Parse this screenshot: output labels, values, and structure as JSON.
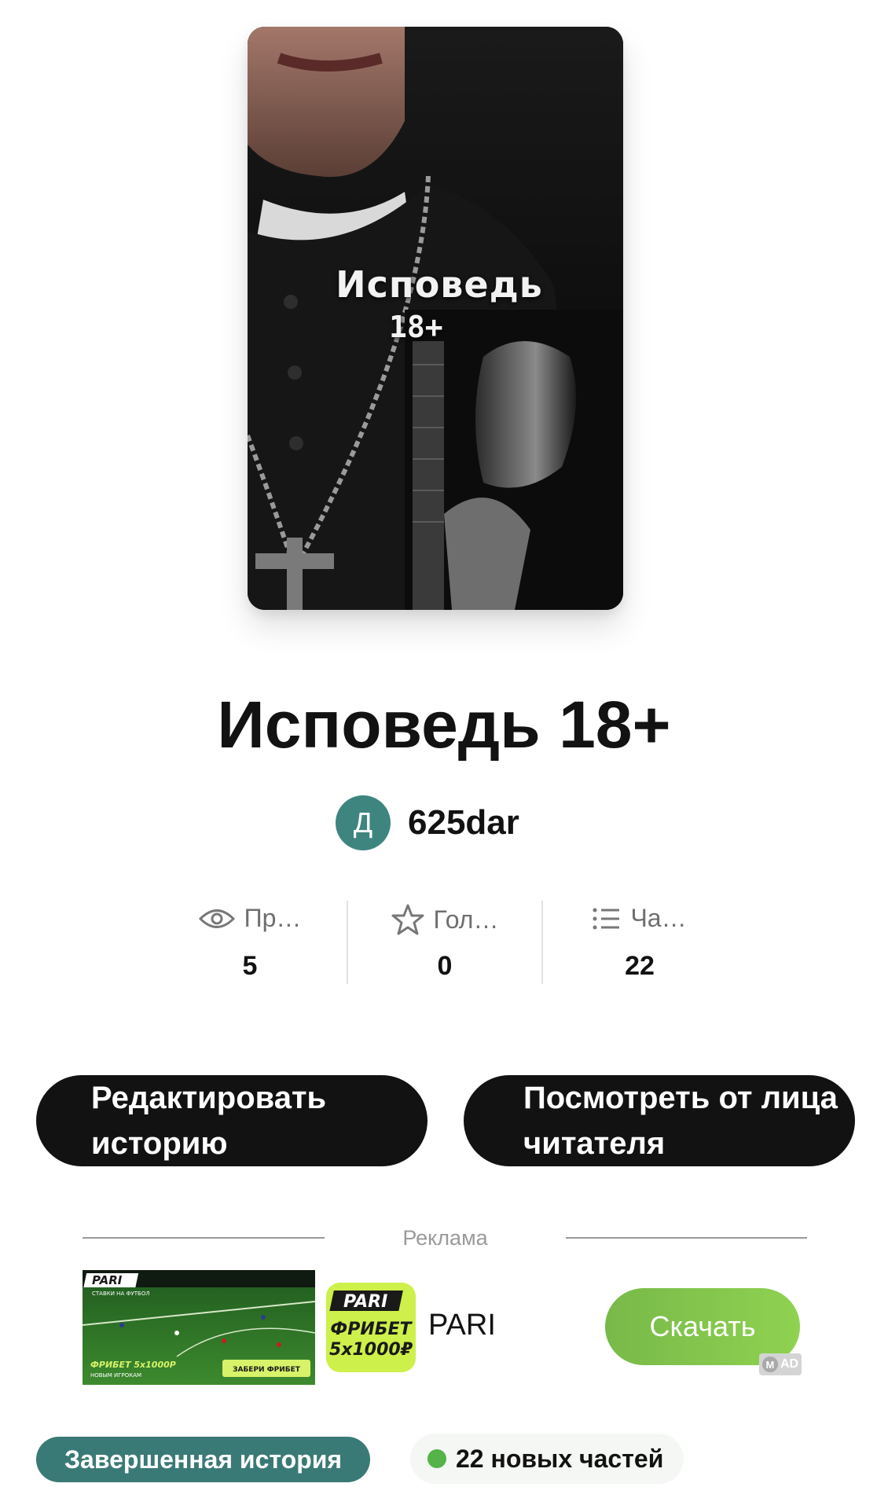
{
  "cover": {
    "title": "Исповедь",
    "subtitle": "18+"
  },
  "story": {
    "title": "Исповедь 18+"
  },
  "author": {
    "initial": "Д",
    "name": "625dar",
    "avatar_color": "#3e8580"
  },
  "stats": [
    {
      "label": "Пр…",
      "value": "5",
      "icon": "eye-icon"
    },
    {
      "label": "Гол…",
      "value": "0",
      "icon": "star-icon"
    },
    {
      "label": "Ча…",
      "value": "22",
      "icon": "list-icon"
    }
  ],
  "actions": {
    "edit_label": "Редактировать историю",
    "reader_view_label": "Посмотреть от лица читателя"
  },
  "ad": {
    "label": "Реклама",
    "logo_brand": "PARI",
    "logo_line1": "ФРИБЕТ",
    "logo_line2": "5x1000₽",
    "thumb_brand": "PARI",
    "thumb_tagline": "СТАВКИ НА ФУТБОЛ",
    "thumb_offer": "ФРИБЕТ 5x1000Р",
    "thumb_offer_sub": "НОВЫМ ИГРОКАМ",
    "thumb_cta": "ЗАБЕРИ ФРИБЕТ",
    "brand": "PARI",
    "download_label": "Скачать",
    "badge_m": "M",
    "badge": "AD",
    "download_color": "#84c64d"
  },
  "tags": {
    "status": "Завершенная история",
    "status_color": "#3a7a76",
    "new_parts": "22 новых частей",
    "new_parts_dot_color": "#55b34a"
  }
}
